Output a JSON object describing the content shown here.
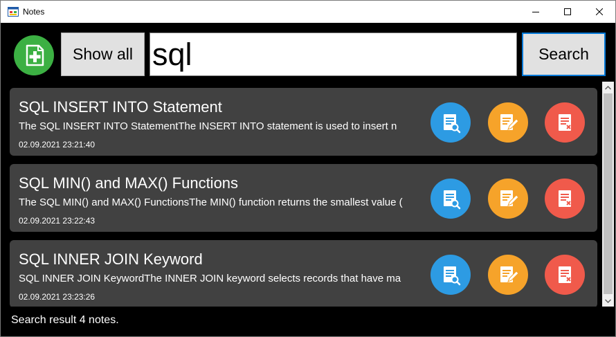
{
  "window": {
    "title": "Notes"
  },
  "toolbar": {
    "show_all_label": "Show all",
    "search_value": "sql",
    "search_label": "Search"
  },
  "notes": [
    {
      "title": "SQL INSERT INTO Statement",
      "body": "The SQL INSERT INTO StatementThe INSERT INTO statement is used to insert n",
      "date": "02.09.2021 23:21:40"
    },
    {
      "title": "SQL MIN() and MAX() Functions",
      "body": "The SQL MIN() and MAX() FunctionsThe MIN() function returns the smallest value (",
      "date": "02.09.2021 23:22:43"
    },
    {
      "title": "SQL INNER JOIN Keyword",
      "body": "SQL INNER JOIN KeywordThe INNER JOIN keyword selects records that have ma",
      "date": "02.09.2021 23:23:26"
    }
  ],
  "icons": {
    "add": "add-note-icon",
    "view": "view-note-icon",
    "edit": "edit-note-icon",
    "delete": "delete-note-icon"
  },
  "colors": {
    "background": "#000000",
    "card": "#414141",
    "add": "#3cb043",
    "view": "#2d9be3",
    "edit": "#f6a32a",
    "delete": "#f05a4b",
    "accent": "#0078d7"
  },
  "status": {
    "text": "Search result 4 notes."
  }
}
